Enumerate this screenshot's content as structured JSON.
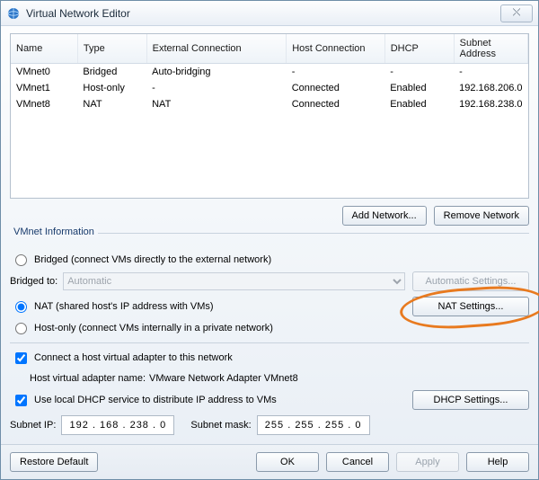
{
  "window": {
    "title": "Virtual Network Editor",
    "close": "⤬"
  },
  "table": {
    "headers": {
      "name": "Name",
      "type": "Type",
      "ext": "External Connection",
      "host": "Host Connection",
      "dhcp": "DHCP",
      "subnet": "Subnet Address"
    },
    "rows": [
      {
        "name": "VMnet0",
        "type": "Bridged",
        "ext": "Auto-bridging",
        "host": "-",
        "dhcp": "-",
        "subnet": "-"
      },
      {
        "name": "VMnet1",
        "type": "Host-only",
        "ext": "-",
        "host": "Connected",
        "dhcp": "Enabled",
        "subnet": "192.168.206.0"
      },
      {
        "name": "VMnet8",
        "type": "NAT",
        "ext": "NAT",
        "host": "Connected",
        "dhcp": "Enabled",
        "subnet": "192.168.238.0"
      }
    ]
  },
  "buttons": {
    "add_network": "Add Network...",
    "remove_network": "Remove Network",
    "auto_settings": "Automatic Settings...",
    "nat_settings": "NAT Settings...",
    "dhcp_settings": "DHCP Settings...",
    "restore_default": "Restore Default",
    "ok": "OK",
    "cancel": "Cancel",
    "apply": "Apply",
    "help": "Help"
  },
  "info": {
    "group_label": "VMnet Information",
    "opt_bridged": "Bridged (connect VMs directly to the external network)",
    "bridged_to": "Bridged to:",
    "bridged_value": "Automatic",
    "opt_nat": "NAT (shared host's IP address with VMs)",
    "opt_hostonly": "Host-only (connect VMs internally in a private network)",
    "chk_hostadapter": "Connect a host virtual adapter to this network",
    "hostadapter_name_lbl": "Host virtual adapter name:",
    "hostadapter_name_val": "VMware Network Adapter VMnet8",
    "chk_dhcp": "Use local DHCP service to distribute IP address to VMs",
    "subnet_ip_lbl": "Subnet IP:",
    "subnet_ip_val": "192 . 168 . 238 . 0",
    "subnet_mask_lbl": "Subnet mask:",
    "subnet_mask_val": "255 . 255 . 255 . 0"
  }
}
